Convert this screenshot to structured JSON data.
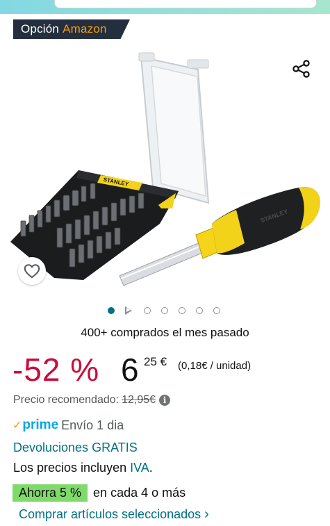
{
  "badge": {
    "prefix": "Opción",
    "brand": "Amazon"
  },
  "product": {
    "case_brand": "STANLEY",
    "handle_brand": "STANLEY"
  },
  "carousel": {
    "total_images": 6,
    "active_index": 0,
    "has_video": true
  },
  "social_proof": "400+ comprados el mes pasado",
  "price": {
    "discount": "-52 %",
    "whole": "6",
    "fraction": "25 €",
    "per_unit": "(0,18€ / unidad)"
  },
  "rrp": {
    "label": "Precio recomendado:",
    "value": "12,95€",
    "info_glyph": "i"
  },
  "delivery": {
    "prime_check": "✓",
    "prime": "prime",
    "shipping": "Envío 1 dia"
  },
  "returns": "Devoluciones GRATIS",
  "vat": {
    "prefix": "Los precios incluyen",
    "link": "IVA",
    "suffix": "."
  },
  "promo": {
    "tag": "Ahorra 5 %",
    "text": "en cada 4 o más"
  },
  "buy_link": "Comprar artículos seleccionados",
  "buy_chevron": "›",
  "colors": {
    "discount_red": "#cc0c39",
    "link_teal": "#007185",
    "prime_blue": "#00a8e1",
    "badge_bg": "#232f3e",
    "badge_accent": "#ff9900",
    "promo_green": "#7fda69"
  },
  "icons": {
    "share": "share-icon",
    "wishlist": "heart-icon",
    "info": "info-icon"
  }
}
